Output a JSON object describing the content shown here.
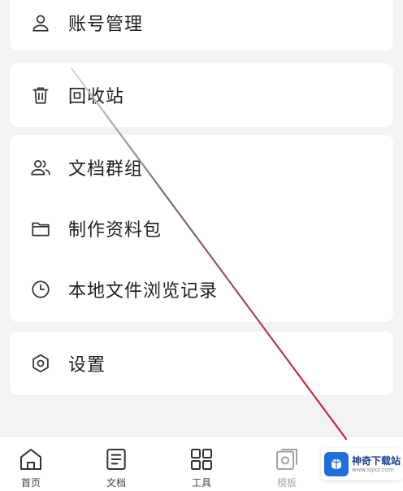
{
  "menu": {
    "group1": [
      {
        "label": "账号管理",
        "icon": "user-icon"
      },
      {
        "label": "回收站",
        "icon": "trash-icon"
      }
    ],
    "group2": [
      {
        "label": "文档群组",
        "icon": "users-icon"
      },
      {
        "label": "制作资料包",
        "icon": "folder-icon"
      },
      {
        "label": "本地文件浏览记录",
        "icon": "clock-icon"
      }
    ],
    "group3": [
      {
        "label": "设置",
        "icon": "settings-icon"
      }
    ]
  },
  "bottom_nav": [
    {
      "label": "首页",
      "icon": "home-icon"
    },
    {
      "label": "文档",
      "icon": "document-icon"
    },
    {
      "label": "工具",
      "icon": "grid-icon"
    },
    {
      "label": "模板",
      "icon": "template-icon"
    }
  ],
  "watermark": {
    "title": "神奇下载站",
    "url": "www.sqxz.com"
  }
}
